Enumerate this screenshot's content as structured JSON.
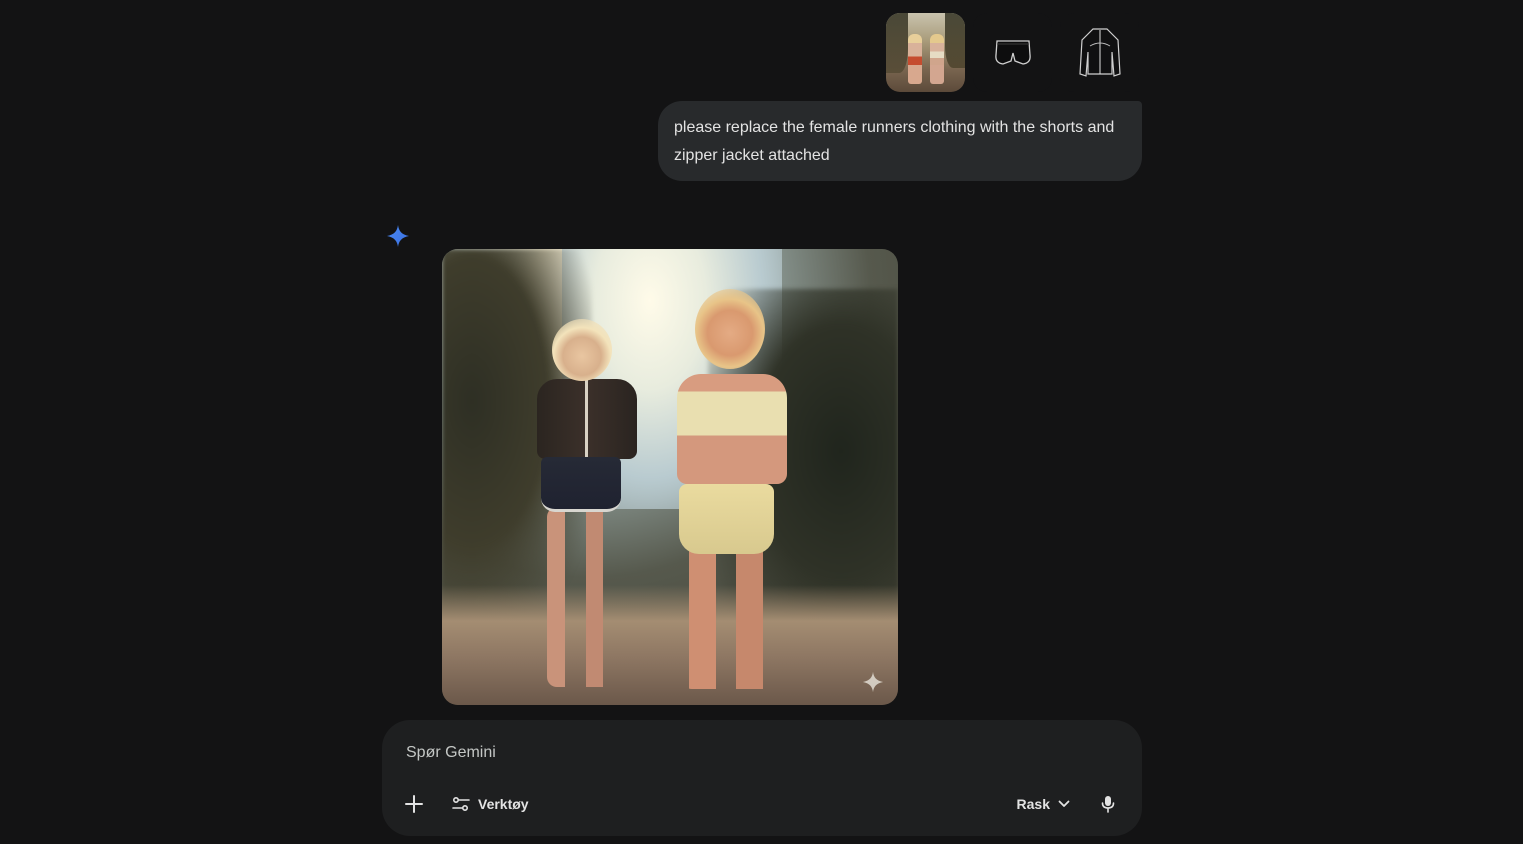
{
  "attachments": [
    {
      "kind": "image",
      "description_icon": "runners-photo-thumbnail"
    },
    {
      "kind": "image",
      "description_icon": "shorts-thumbnail"
    },
    {
      "kind": "image",
      "description_icon": "zipper-jacket-thumbnail"
    }
  ],
  "user_message": {
    "text": "please replace the female runners clothing with the shorts and zipper jacket attached"
  },
  "response": {
    "icon": "gemini-sparkle-icon",
    "image_icon": "generated-image",
    "watermark_icon": "sparkle-watermark-icon"
  },
  "composer": {
    "placeholder": "Spør Gemini",
    "value": "",
    "plus_icon": "plus-icon",
    "tools_label": "Verktøy",
    "tools_icon": "tune-icon",
    "mode_label": "Rask",
    "mode_icon": "chevron-down-icon",
    "mic_icon": "microphone-icon"
  },
  "colors": {
    "background": "#131314",
    "bubble": "#282a2c",
    "composer": "#1e1f20",
    "text": "#e3e3e3",
    "accent": "#4285f4"
  }
}
